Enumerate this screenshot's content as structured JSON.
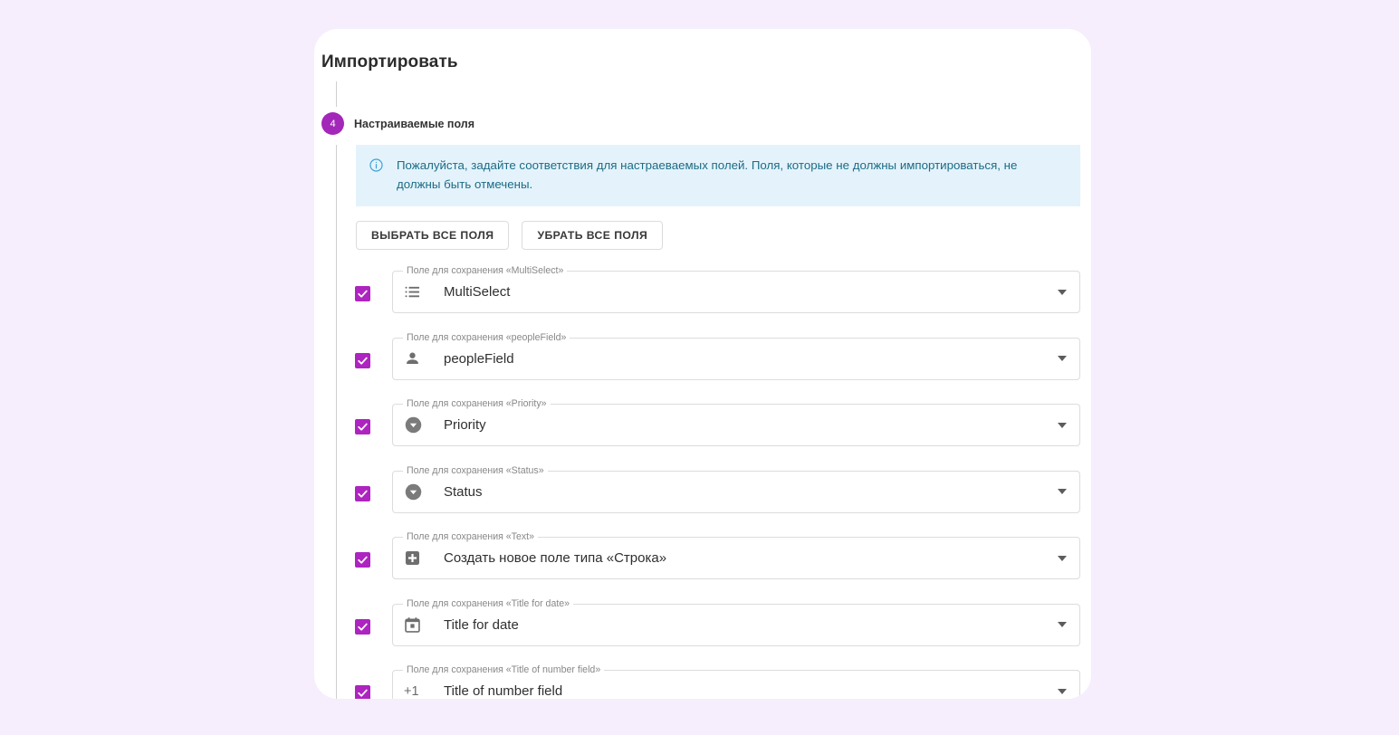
{
  "page": {
    "background_color": "#f6eefc",
    "accent_color": "#a327b8"
  },
  "card": {
    "title": "Импортировать"
  },
  "step": {
    "number": "4",
    "label": "Настраиваемые поля"
  },
  "alert": {
    "icon": "info-icon",
    "text": "Пожалуйста, задайте соответствия для настраеваемых полей. Поля, которые не должны импортироваться, не должны быть отмечены.",
    "background_color": "#e4f3fb",
    "text_color": "#1c6b86"
  },
  "actions": {
    "select_all_label": "ВЫБРАТЬ ВСЕ ПОЛЯ",
    "deselect_all_label": "УБРАТЬ ВСЕ ПОЛЯ"
  },
  "fields": [
    {
      "checked": true,
      "legend": "Поле для сохранения «MultiSelect»",
      "icon": "list-icon",
      "value": "MultiSelect"
    },
    {
      "checked": true,
      "legend": "Поле для сохранения «peopleField»",
      "icon": "person-icon",
      "value": "peopleField"
    },
    {
      "checked": true,
      "legend": "Поле для сохранения «Priority»",
      "icon": "dropdown-circle-icon",
      "value": "Priority"
    },
    {
      "checked": true,
      "legend": "Поле для сохранения «Status»",
      "icon": "dropdown-circle-icon",
      "value": "Status"
    },
    {
      "checked": true,
      "legend": "Поле для сохранения «Text»",
      "icon": "plus-square-icon",
      "value": "Создать новое поле типа «Строка»"
    },
    {
      "checked": true,
      "legend": "Поле для сохранения «Title for date»",
      "icon": "calendar-icon",
      "value": "Title for date"
    },
    {
      "checked": true,
      "legend": "Поле для сохранения «Title of number field»",
      "icon": "plus-one-icon",
      "value": "Title of number field"
    }
  ]
}
